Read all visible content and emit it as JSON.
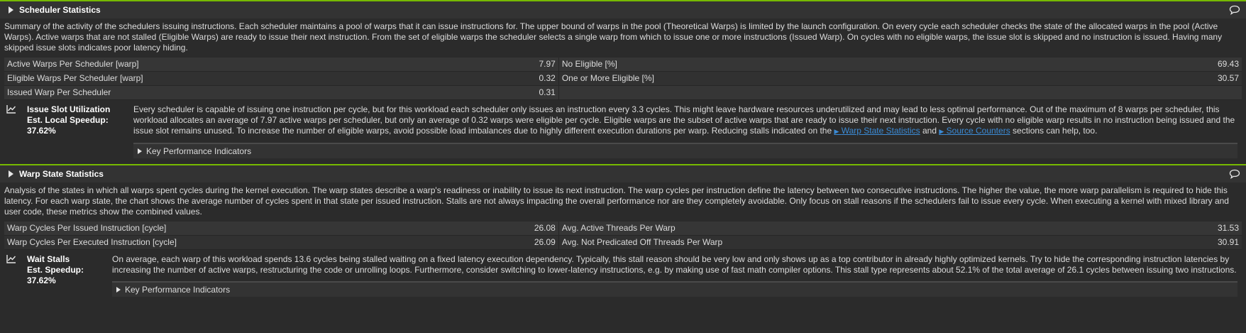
{
  "scheduler": {
    "title": "Scheduler Statistics",
    "description": "Summary of the activity of the schedulers issuing instructions. Each scheduler maintains a pool of warps that it can issue instructions for. The upper bound of warps in the pool (Theoretical Warps) is limited by the launch configuration. On every cycle each scheduler checks the state of the allocated warps in the pool (Active Warps). Active warps that are not stalled (Eligible Warps) are ready to issue their next instruction. From the set of eligible warps the scheduler selects a single warp from which to issue one or more instructions (Issued Warp). On cycles with no eligible warps, the issue slot is skipped and no instruction is issued. Having many skipped issue slots indicates poor latency hiding.",
    "metrics": [
      {
        "l1": "Active Warps Per Scheduler [warp]",
        "v1": "7.97",
        "l2": "No Eligible [%]",
        "v2": "69.43"
      },
      {
        "l1": "Eligible Warps Per Scheduler [warp]",
        "v1": "0.32",
        "l2": "One or More Eligible [%]",
        "v2": "30.57"
      },
      {
        "l1": "Issued Warp Per Scheduler",
        "v1": "0.31",
        "l2": "",
        "v2": ""
      }
    ],
    "rule": {
      "name": "Issue Slot Utilization",
      "speedup": "Est. Local Speedup: 37.62%",
      "text_before": "Every scheduler is capable of issuing one instruction per cycle, but for this workload each scheduler only issues an instruction every 3.3 cycles. This might leave hardware resources underutilized and may lead to less optimal performance. Out of the maximum of 8 warps per scheduler, this workload allocates an average of 7.97 active warps per scheduler, but only an average of 0.32 warps were eligible per cycle. Eligible warps are the subset of active warps that are ready to issue their next instruction. Every cycle with no eligible warp results in no instruction being issued and the issue slot remains unused. To increase the number of eligible warps, avoid possible load imbalances due to highly different execution durations per warp. Reducing stalls indicated on the ",
      "link1": "Warp State Statistics",
      "text_mid": " and ",
      "link2": "Source Counters",
      "text_after": " sections can help, too."
    },
    "kpi_label": "Key Performance Indicators"
  },
  "warp": {
    "title": "Warp State Statistics",
    "description": "Analysis of the states in which all warps spent cycles during the kernel execution. The warp states describe a warp's readiness or inability to issue its next instruction. The warp cycles per instruction define the latency between two consecutive instructions. The higher the value, the more warp parallelism is required to hide this latency. For each warp state, the chart shows the average number of cycles spent in that state per issued instruction. Stalls are not always impacting the overall performance nor are they completely avoidable. Only focus on stall reasons if the schedulers fail to issue every cycle. When executing a kernel with mixed library and user code, these metrics show the combined values.",
    "metrics": [
      {
        "l1": "Warp Cycles Per Issued Instruction [cycle]",
        "v1": "26.08",
        "l2": "Avg. Active Threads Per Warp",
        "v2": "31.53"
      },
      {
        "l1": "Warp Cycles Per Executed Instruction [cycle]",
        "v1": "26.09",
        "l2": "Avg. Not Predicated Off Threads Per Warp",
        "v2": "30.91"
      }
    ],
    "rule": {
      "name": "Wait Stalls",
      "speedup": "Est. Speedup: 37.62%",
      "text": "On average, each warp of this workload spends 13.6 cycles being stalled waiting on a fixed latency execution dependency. Typically, this stall reason should be very low and only shows up as a top contributor in already highly optimized kernels. Try to hide the corresponding instruction latencies by increasing the number of active warps, restructuring the code or unrolling loops. Furthermore, consider switching to lower-latency instructions, e.g. by making use of fast math compiler options. This stall type represents about 52.1% of the total average of 26.1 cycles between issuing two instructions."
    },
    "kpi_label": "Key Performance Indicators"
  },
  "colors": {
    "accent": "#76b900",
    "link": "#3b8bd6",
    "background": "#2b2b2b"
  },
  "icons": [
    "expand-triangle-icon",
    "comment-icon",
    "line-chart-icon"
  ]
}
